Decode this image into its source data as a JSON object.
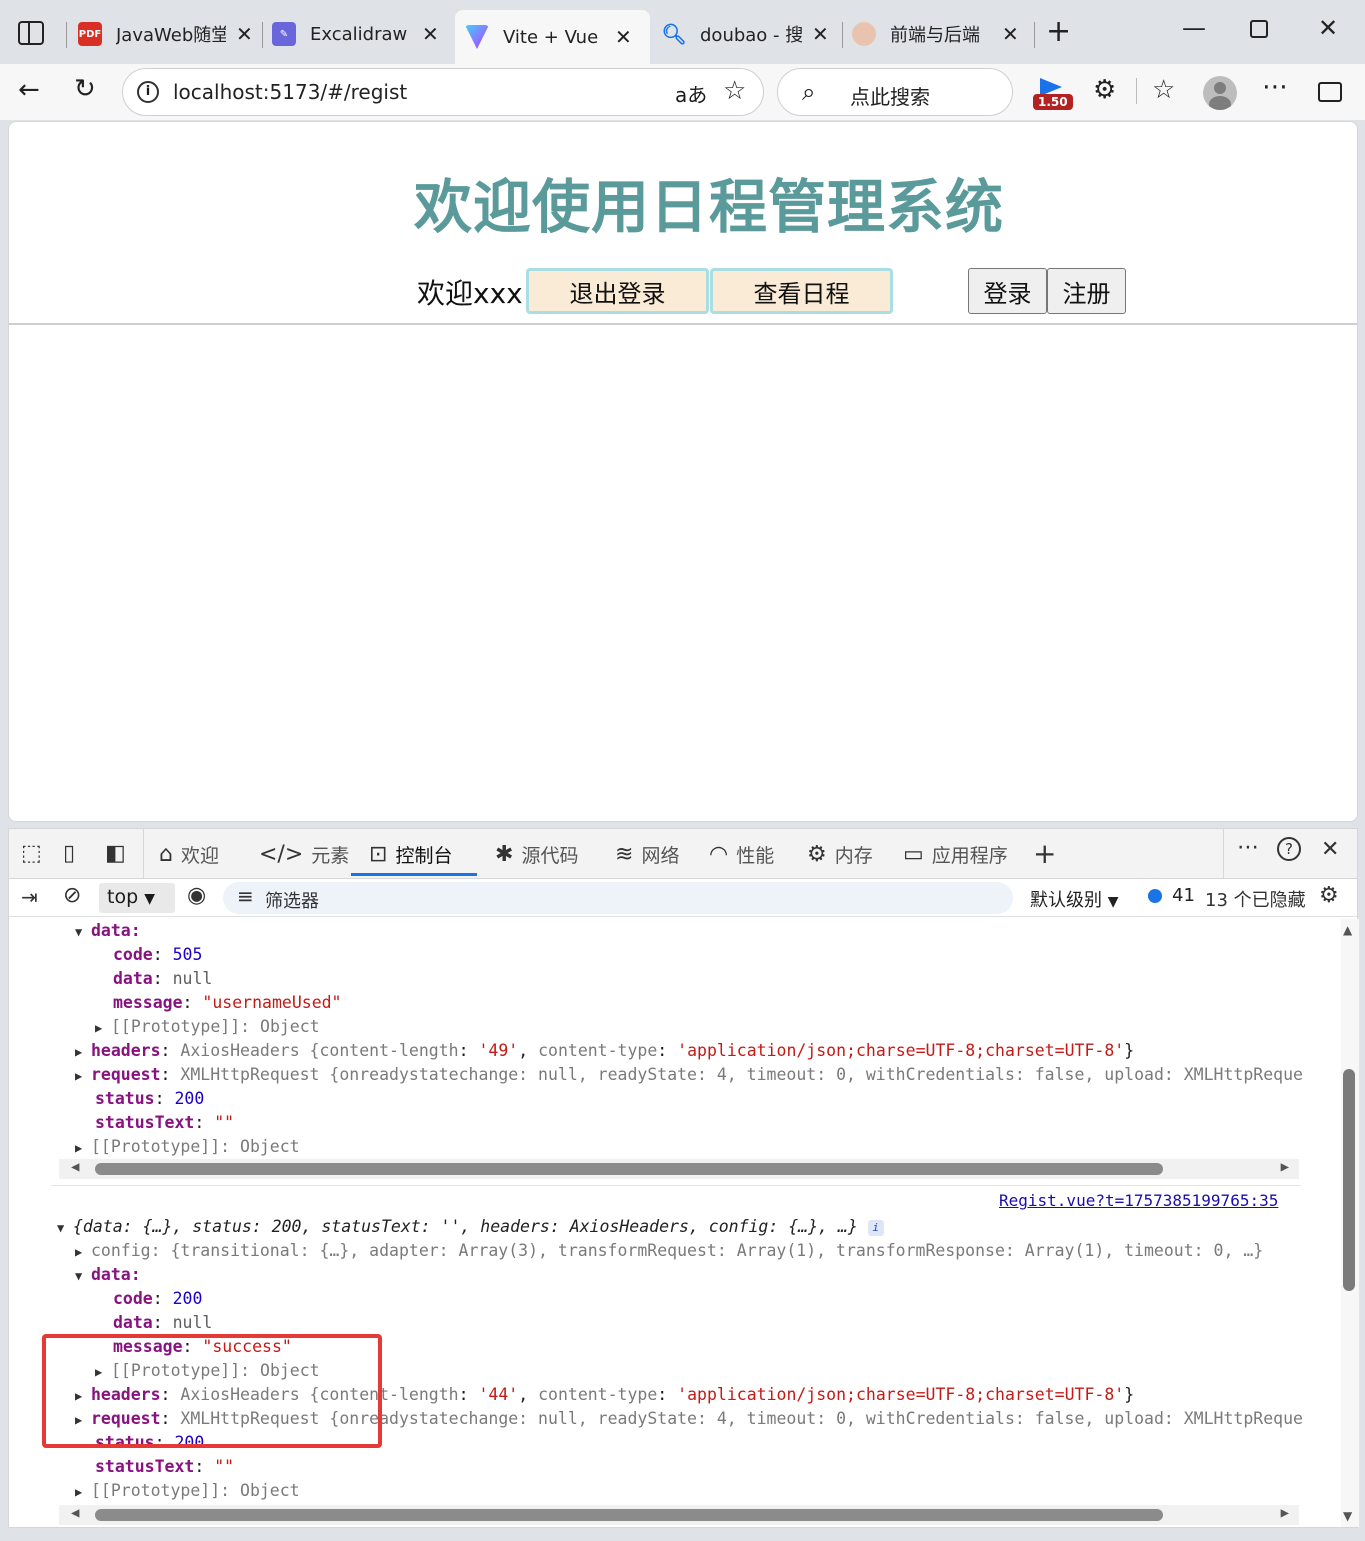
{
  "browser": {
    "tabs": [
      {
        "title": "JavaWeb随堂",
        "favicon": "pdf-icon"
      },
      {
        "title": "Excalidraw W",
        "favicon": "excalidraw-icon"
      },
      {
        "title": "Vite + Vue",
        "favicon": "vite-icon",
        "active": true
      },
      {
        "title": "doubao - 搜",
        "favicon": "search-icon"
      },
      {
        "title": "前端与后端",
        "favicon": "avatar-icon"
      }
    ],
    "url": "localhost:5173/#/regist",
    "search_placeholder": "点此搜索",
    "extension_badge": "1.50"
  },
  "app": {
    "title": "欢迎使用日程管理系统",
    "welcome": "欢迎xxx",
    "logout_label": "退出登录",
    "schedule_label": "查看日程",
    "login_label": "登录",
    "register_label": "注册",
    "colors": {
      "title": "#5b9a9a",
      "nav_button_bg": "#faebd7",
      "nav_button_border": "#a9dfe4"
    }
  },
  "devtools": {
    "tabs": [
      "欢迎",
      "元素",
      "控制台",
      "源代码",
      "网络",
      "性能",
      "内存",
      "应用程序"
    ],
    "active_tab": "控制台",
    "context": "top",
    "filter_placeholder": "筛选器",
    "level": "默认级别",
    "message_count": "41",
    "hidden_count": "13 个已隐藏",
    "console": {
      "entry1": {
        "data_key": "data:",
        "code_key": "code",
        "code": "505",
        "data_key2": "data",
        "data_val": "null",
        "message_key": "message",
        "message": "\"usernameUsed\"",
        "proto_inner": "[[Prototype]]: Object",
        "headers_key": "headers",
        "headers_val": "AxiosHeaders {",
        "headers_cl_key": "content-length",
        "headers_cl": "'49'",
        "headers_ct_key": "content-type",
        "headers_ct": "'application/json;charse=UTF-8;charset=UTF-8'",
        "request_key": "request",
        "request_val": "XMLHttpRequest {",
        "request_rest": "onreadystatechange: null, readyState: 4, timeout: 0, withCredentials: false, upload: XMLHttpReque",
        "status_key": "status",
        "status": "200",
        "status_text_key": "statusText",
        "status_text": "\"\"",
        "proto": "[[Prototype]]: Object"
      },
      "source_link": "Regist.vue?t=1757385199765:35",
      "entry2": {
        "summary": "{data: {…}, status: 200, statusText: '', headers: AxiosHeaders, config: {…}, …}",
        "config_line": "config: {transitional: {…}, adapter: Array(3), transformRequest: Array(1), transformResponse: Array(1), timeout: 0, …}",
        "data_key": "data:",
        "code_key": "code",
        "code": "200",
        "data_key2": "data",
        "data_val": "null",
        "message_key": "message",
        "message": "\"success\"",
        "proto_inner": "[[Prototype]]: Object",
        "headers_key": "headers",
        "headers_val": "AxiosHeaders {",
        "headers_cl_key": "content-length",
        "headers_cl": "'44'",
        "headers_ct_key": "content-type",
        "headers_ct": "'application/json;charse=UTF-8;charset=UTF-8'",
        "request_key": "request",
        "request_val": "XMLHttpRequest {",
        "request_rest": "onreadystatechange: null, readyState: 4, timeout: 0, withCredentials: false, upload: XMLHttpReque",
        "status_key": "status",
        "status": "200",
        "status_text_key": "statusText",
        "status_text": "\"\"",
        "proto": "[[Prototype]]: Object"
      }
    }
  }
}
